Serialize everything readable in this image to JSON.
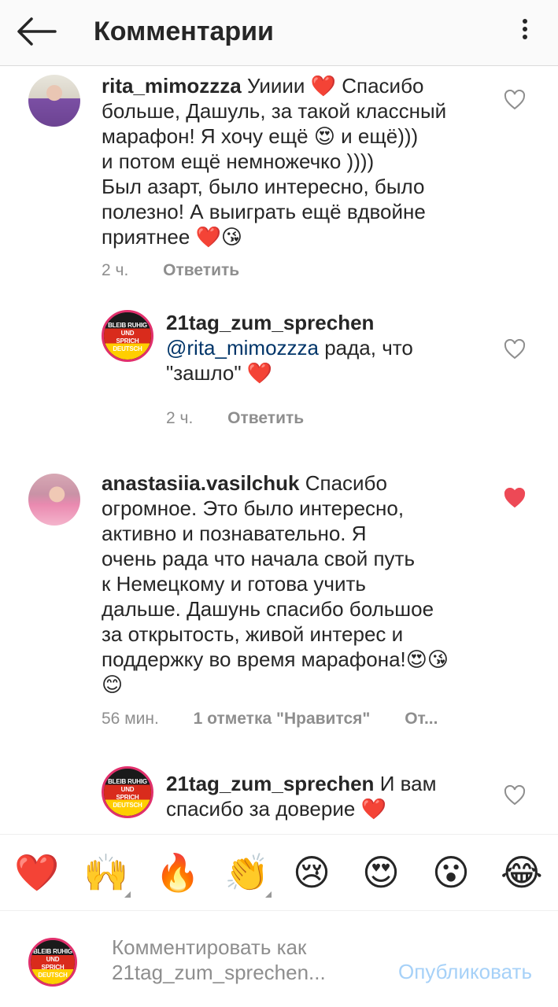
{
  "header": {
    "title": "Комментарии"
  },
  "comments": [
    {
      "username": "rita_mimozzza",
      "lines": [
        "Уииии ❤️ Спасибо",
        "больше, Дашуль, за такой классный",
        "марафон! Я хочу ещё 😍 и ещё)))",
        "и потом ещё немножечко ))))",
        "Был азарт, было интересно, было",
        "полезно! А выиграть ещё вдвойне",
        "приятнее ❤️😘"
      ],
      "time": "2 ч.",
      "reply": "Ответить"
    },
    {
      "username": "21tag_zum_sprechen",
      "mention": "@rita_mimozzza",
      "lines": [
        " рада, что",
        "\"зашло\" ❤️"
      ],
      "time": "2 ч.",
      "reply": "Ответить"
    },
    {
      "username": "anastasiia.vasilchuk",
      "lines": [
        "Спасибо",
        "огромное. Это было интересно,",
        "активно и познавательно. Я",
        "очень рада что начала свой путь",
        "к Немецкому и готова учить",
        "дальше. Дашунь спасибо большое",
        "за открытость, живой интерес и",
        "поддержку во время марафона!😍😘",
        "😊"
      ],
      "time": "56 мин.",
      "likes": "1 отметка \"Нравится\"",
      "reply": "От..."
    },
    {
      "username": "21tag_zum_sprechen",
      "lines": [
        "И вам",
        "спасибо за доверие ❤️"
      ]
    }
  ],
  "brand_avatar": {
    "l1": "BLEIB RUHIG",
    "l2": "UND",
    "l3": "SPRICH",
    "l4": "DEUTSCH"
  },
  "reactions": [
    "❤️",
    "🙌",
    "🔥",
    "👏",
    "😢",
    "😍",
    "😮",
    "😂"
  ],
  "composer": {
    "placeholder": "Комментировать как 21tag_zum_sprechen...",
    "publish": "Опубликовать"
  },
  "colors": {
    "like_active": "#ed4956",
    "publish_disabled": "#a6d1f8",
    "mention": "#003569"
  }
}
